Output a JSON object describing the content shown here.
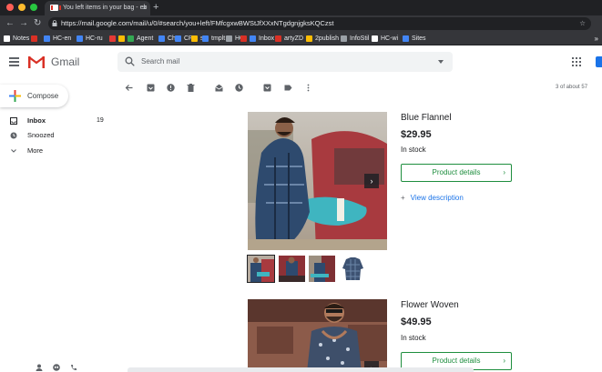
{
  "browser": {
    "tab_title": "You left items in your bag - eb",
    "tab_close": "×",
    "new_tab": "+",
    "url": "https://mail.google.com/mail/u/0/#search/you+left/FMfcgxwBWStJfXXxNTgdgnjgksKQCzst",
    "back": "←",
    "forward": "→",
    "reload": "↻",
    "star": "☆",
    "bookmarks": [
      {
        "label": "Notes",
        "color": "#ffffff"
      },
      {
        "label": "",
        "color": "#d93025"
      },
      {
        "label": "HC-en",
        "color": "#4285f4"
      },
      {
        "label": "HC-ru",
        "color": "#4285f4"
      },
      {
        "label": "",
        "color": "#e53935"
      },
      {
        "label": "",
        "color": "#fbbc04"
      },
      {
        "label": "Agent",
        "color": "#34a853"
      },
      {
        "label": "Ch",
        "color": "#4285f4"
      },
      {
        "label": "CP",
        "color": "#4285f4"
      },
      {
        "label": "s",
        "color": "#fbbc04"
      },
      {
        "label": "tmplt",
        "color": "#4285f4"
      },
      {
        "label": "HC",
        "color": "#9aa0a6"
      },
      {
        "label": "",
        "color": "#d93025"
      },
      {
        "label": "Inbox",
        "color": "#4285f4"
      },
      {
        "label": "artyZD",
        "color": "#d93025"
      },
      {
        "label": "2publish",
        "color": "#fbbc04"
      },
      {
        "label": "InfoStil",
        "color": "#9aa0a6"
      },
      {
        "label": "HC-wi",
        "color": "#ffffff"
      },
      {
        "label": "Sites",
        "color": "#4285f4"
      }
    ],
    "bookmarks_more": "»"
  },
  "gmail": {
    "logo_text": "Gmail",
    "search_placeholder": "Search mail",
    "compose_label": "Compose",
    "sidebar": [
      {
        "label": "Inbox",
        "count": "19",
        "bold": true,
        "icon": "inbox-icon"
      },
      {
        "label": "Snoozed",
        "count": "",
        "bold": false,
        "icon": "clock-icon"
      },
      {
        "label": "More",
        "count": "",
        "bold": false,
        "icon": "chevron-down-icon"
      }
    ],
    "pagination": "3 of about 57"
  },
  "products": [
    {
      "name": "Blue Flannel",
      "price": "$29.95",
      "stock": "In stock",
      "button": "Product details",
      "chevron": "›",
      "description_link": "View description",
      "description_plus": "+",
      "next": "›"
    },
    {
      "name": "Flower Woven",
      "price": "$49.95",
      "stock": "In stock",
      "button": "Product details",
      "chevron": "›",
      "next": "›"
    }
  ],
  "colors": {
    "gmail_red": "#d93025",
    "green": "#1e8e3e",
    "link_blue": "#1a73e8",
    "chrome_dark": "#202124"
  }
}
